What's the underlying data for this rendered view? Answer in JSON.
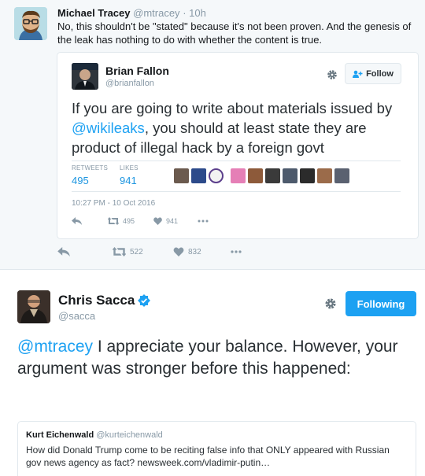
{
  "top_tweet": {
    "name": "Michael Tracey",
    "handle": "@mtracey",
    "separator": "·",
    "time": "10h",
    "text": "No, this shouldn't be \"stated\" because it's not been proven. And the genesis of the leak has nothing to do with whether the content is true.",
    "actions": {
      "retweets": "522",
      "likes": "832"
    },
    "embedded": {
      "name": "Brian Fallon",
      "handle": "@brianfallon",
      "follow_label": "Follow",
      "text_before": "If you are going to write about materials issued by ",
      "mention": "@wikileaks",
      "text_after": ", you should at least state they are product of illegal hack by a foreign govt",
      "retweets_label": "RETWEETS",
      "retweets": "495",
      "likes_label": "LIKES",
      "likes": "941",
      "timestamp": "10:27 PM - 10 Oct 2016",
      "actions": {
        "retweets": "495",
        "likes": "941"
      }
    }
  },
  "bottom_tweet": {
    "name": "Chris Sacca",
    "handle": "@sacca",
    "following_label": "Following",
    "mention": "@mtracey",
    "text": " I appreciate your balance. However, your argument was stronger before this happened:",
    "quote": {
      "name": "Kurt Eichenwald",
      "handle": "@kurteichenwald",
      "text": "How did Donald Trump come to be reciting false info that ONLY appeared with Russian gov news agency as fact? newsweek.com/vladimir-putin…"
    }
  },
  "colors": {
    "accent": "#1da1f2",
    "muted": "#8899a6",
    "verified": "#1da1f2"
  },
  "icons": [
    "reply-icon",
    "retweet-icon",
    "like-icon",
    "more-icon",
    "gear-icon",
    "follow-person-icon",
    "verified-badge-icon"
  ]
}
